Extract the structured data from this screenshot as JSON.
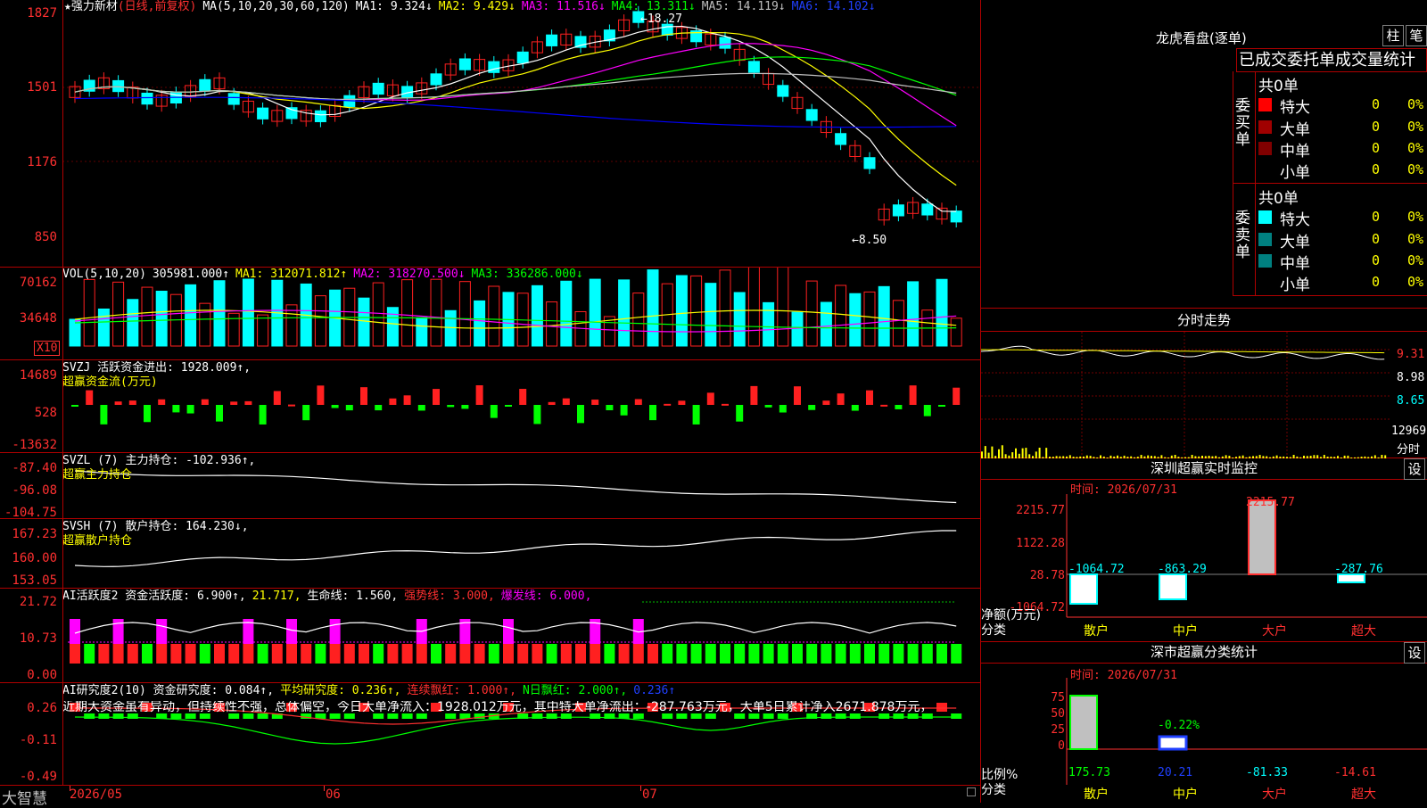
{
  "colors": {
    "up": "#ff2020",
    "down": "#00ffff",
    "grid": "#b00000",
    "axis": "#ff3030",
    "ma1": "#ffffff",
    "ma2": "#ffff00",
    "ma3": "#ff00ff",
    "ma4": "#00ff00",
    "ma5": "#c0c0c0",
    "ma6": "#0000ff"
  },
  "main": {
    "title": "★强力新材",
    "mode": "(日线,前复权)",
    "ma_label": "MA(5,10,20,30,60,120)",
    "ma1": "MA1: 9.324↓",
    "ma2": "MA2: 9.429↓",
    "ma3": "MA3: 11.516↓",
    "ma4": "MA4: 13.311↓",
    "ma5": "MA5: 14.119↓",
    "ma6": "MA6: 14.102↓",
    "yticks": [
      "1827",
      "1501",
      "1176",
      "850"
    ],
    "high_label": "←18.27",
    "low_label": "←8.50"
  },
  "vol": {
    "label": "VOL(5,10,20)",
    "value": "305981.000↑",
    "ma1": "MA1: 312071.812↑",
    "ma2": "MA2: 318270.500↓",
    "ma3": "MA3: 336286.000↓",
    "yticks": [
      "70162",
      "34648"
    ],
    "unit": "X10"
  },
  "svzj": {
    "label": "SVZJ  活跃资金进出: 1928.009↑,",
    "sub": "超赢资金流(万元)",
    "yticks": [
      "14689",
      "528",
      "-13632"
    ]
  },
  "svzl": {
    "label": "SVZL (7) 主力持仓: -102.936↑,",
    "sub": "超赢主力持仓",
    "yticks": [
      "-87.40",
      "-96.08",
      "-104.75"
    ]
  },
  "svsh": {
    "label": "SVSH (7) 散户持仓: 164.230↓,",
    "sub": "超赢散户持仓",
    "yticks": [
      "167.23",
      "160.00",
      "153.05"
    ]
  },
  "ai1": {
    "label": "AI活跃度2 资金活跃度: 6.900↑,",
    "v2": "21.717,",
    "v3": "生命线: 1.560,",
    "v4": "强势线: 3.000,",
    "v5": "爆发线: 6.000,",
    "yticks": [
      "21.72",
      "10.73",
      "0.00"
    ]
  },
  "ai2": {
    "label": "AI研究度2(10) 资金研究度: 0.084↑,",
    "v2": "平均研究度: 0.236↑,",
    "v3": "连续飘红: 1.000↑,",
    "v4": "N日飘红: 2.000↑,",
    "v5": "0.236↑",
    "comment": "近期大资金虽有异动，但持续性不强，总体偏空，今日大单净流入：1928.012万元，其中特大单净流出：-287.763万元，大单5日累计净入2671.878万元，",
    "yticks": [
      "0.26",
      "-0.11",
      "-0.49"
    ]
  },
  "bottom": {
    "brand": "大智慧",
    "d1": "2026/05",
    "d2": "06",
    "d3": "07"
  },
  "right": {
    "lhb_title": "龙虎看盘(逐单)",
    "btn_zhu": "柱",
    "btn_bi": "笔",
    "tab_label": "已成交委托单成交量统计",
    "buy_group": "委买单",
    "sell_group": "委卖单",
    "buy_total": "共0单",
    "sell_total": "共0单",
    "buy_rows": [
      {
        "label": "特大",
        "n": "0",
        "p": "0%",
        "color": "#ff0000"
      },
      {
        "label": "大单",
        "n": "0",
        "p": "0%",
        "color": "#a00000"
      },
      {
        "label": "中单",
        "n": "0",
        "p": "0%",
        "color": "#800000"
      },
      {
        "label": "小单",
        "n": "0",
        "p": "0%",
        "color": ""
      }
    ],
    "sell_rows": [
      {
        "label": "特大",
        "n": "0",
        "p": "0%",
        "color": "#00ffff"
      },
      {
        "label": "大单",
        "n": "0",
        "p": "0%",
        "color": "#008080"
      },
      {
        "label": "中单",
        "n": "0",
        "p": "0%",
        "color": "#008080"
      },
      {
        "label": "小单",
        "n": "0",
        "p": "0%",
        "color": ""
      }
    ],
    "fs_title": "分时走势",
    "fs_yticks": [
      "9.31",
      "8.98",
      "8.65"
    ],
    "fs_vol": "12969",
    "fs_unit": "分时",
    "m1_title": "深圳超赢实时监控",
    "m1_btn": "设",
    "m1_time": "时间: 2026/07/31",
    "m1_yticks": [
      "2215.77",
      "1122.28",
      "28.78",
      "-1064.72"
    ],
    "m1_ylabel": "净额(万元)",
    "m1_xlabel": "分类",
    "m1_vals": [
      {
        "cat": "散户",
        "v": "-1064.72"
      },
      {
        "cat": "中户",
        "v": "-863.29"
      },
      {
        "cat": "大户",
        "v": "2215.77"
      },
      {
        "cat": "超大",
        "v": "-287.76"
      }
    ],
    "m2_title": "深市超赢分类统计",
    "m2_btn": "设",
    "m2_time": "时间: 2026/07/31",
    "m2_yticks": [
      "75",
      "50",
      "25",
      "0"
    ],
    "m2_ylabel": "比例%",
    "m2_xlabel": "分类",
    "m2_pct": "-0.22%",
    "m2_vals": [
      {
        "cat": "散户",
        "v": "175.73"
      },
      {
        "cat": "中户",
        "v": "20.21"
      },
      {
        "cat": "大户",
        "v": "-81.33"
      },
      {
        "cat": "超大",
        "v": "-14.61"
      }
    ]
  }
}
